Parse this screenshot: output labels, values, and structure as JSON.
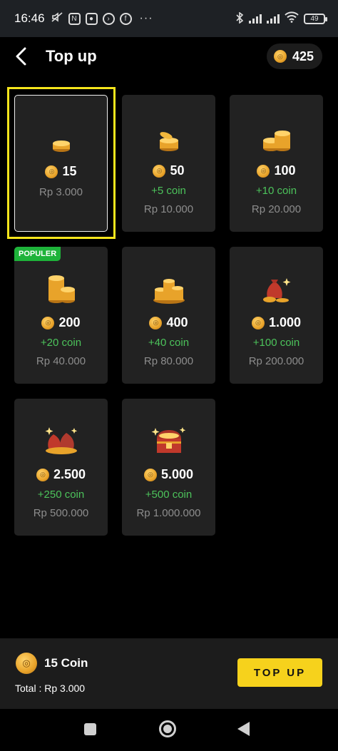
{
  "status_bar": {
    "time": "16:46",
    "battery": "49",
    "icons": [
      "mute-icon",
      "nfc-icon",
      "app-icon",
      "message-icon",
      "facebook-icon",
      "more-dots-icon",
      "bluetooth-icon",
      "signal-icon",
      "signal-icon",
      "wifi-icon",
      "battery-icon"
    ]
  },
  "header": {
    "title": "Top up",
    "balance": "425"
  },
  "packages": [
    {
      "amount": "15",
      "bonus": "",
      "price": "Rp 3.000",
      "badge": "",
      "art": "coin-stack-small-icon",
      "selected": true
    },
    {
      "amount": "50",
      "bonus": "+5 coin",
      "price": "Rp 10.000",
      "badge": "",
      "art": "coin-stack-icon",
      "selected": false
    },
    {
      "amount": "100",
      "bonus": "+10 coin",
      "price": "Rp 20.000",
      "badge": "",
      "art": "coin-stacks-icon",
      "selected": false
    },
    {
      "amount": "200",
      "bonus": "+20 coin",
      "price": "Rp 40.000",
      "badge": "POPULER",
      "art": "coin-tower-icon",
      "selected": false
    },
    {
      "amount": "400",
      "bonus": "+40 coin",
      "price": "Rp 80.000",
      "badge": "",
      "art": "coin-pile-icon",
      "selected": false
    },
    {
      "amount": "1.000",
      "bonus": "+100 coin",
      "price": "Rp 200.000",
      "badge": "",
      "art": "money-bag-icon",
      "selected": false
    },
    {
      "amount": "2.500",
      "bonus": "+250 coin",
      "price": "Rp 500.000",
      "badge": "",
      "art": "money-bags-icon",
      "selected": false
    },
    {
      "amount": "5.000",
      "bonus": "+500 coin",
      "price": "Rp 1.000.000",
      "badge": "",
      "art": "treasure-chest-icon",
      "selected": false
    }
  ],
  "footer": {
    "selected_label": "15 Coin",
    "total": "Total : Rp 3.000",
    "button_label": "TOP UP"
  },
  "colors": {
    "accent": "#f6d21c",
    "bonus": "#4cc35b",
    "badge": "#1eb33a",
    "highlight": "#f5e51c"
  }
}
